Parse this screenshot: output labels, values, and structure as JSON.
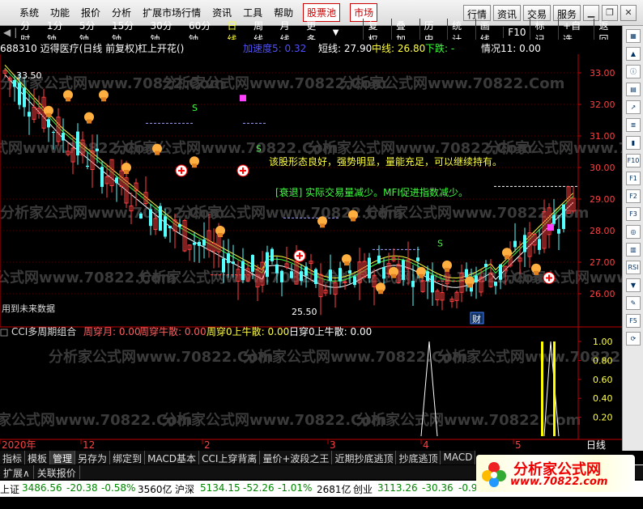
{
  "menu": {
    "items": [
      "系统",
      "功能",
      "报价",
      "分析",
      "扩展市场行情",
      "资讯",
      "工具",
      "帮助"
    ],
    "stock_pool": "股票池",
    "market": "市场",
    "right_buttons": [
      "行情",
      "资讯",
      "交易",
      "服务"
    ]
  },
  "period_bar": {
    "periods": [
      "分时",
      "1分钟",
      "5分钟",
      "15分钟",
      "30分钟",
      "60分钟",
      "日线",
      "周线",
      "月线",
      "更多"
    ],
    "active": "日线",
    "right": [
      "复权",
      "叠加",
      "历史",
      "统计",
      "画线",
      "F10",
      "标记",
      "+自选",
      "返回"
    ]
  },
  "info": {
    "code_name": "688310 迈得医疗(日线 前复权)",
    "indicator": "杠上开花()",
    "accel": "加速度5: 0.32",
    "short_line": "短线: 27.90",
    "mid_line": "中线: 26.80",
    "down": "下跌: -",
    "mood": "情况11: 0.00"
  },
  "main_chart": {
    "price_ticks": [
      "33.00",
      "32.00",
      "31.00",
      "30.00",
      "29.00",
      "28.00",
      "27.00",
      "26.00"
    ],
    "price_top_label": "33.50",
    "price_low_label": "25.50",
    "annotation1": "该股形态良好，强势明显，量能充足，可以继续持有。",
    "annotation2": "[衰退] 实际交易量减少。MFI促进指数减少。",
    "future_text": "用到未来数据",
    "cai": "财",
    "watermark": "分析家公式网www.70822.Com"
  },
  "sub_chart": {
    "title": "CCI多周期组合",
    "labels": [
      {
        "text": "周穿月: 0.00",
        "color": "#ff6060"
      },
      {
        "text": "周穿牛散: 0.00",
        "color": "#ff6060"
      },
      {
        "text": "周穿0上牛散: 0.00",
        "color": "#ffff40"
      },
      {
        "text": "日穿0上牛散: 0.00",
        "color": "#ffffff"
      }
    ],
    "ticks": [
      "1.00",
      "0.80",
      "0.60",
      "0.40",
      "0.20"
    ]
  },
  "x_axis": {
    "labels": [
      "2020年",
      "12",
      "2",
      "3",
      "4",
      "5"
    ],
    "period": "日线"
  },
  "tabs": [
    "指标",
    "模板",
    "管理",
    "另存为",
    "绑定到",
    "MACD基本",
    "CCI上穿背离",
    "量价+波段之王",
    "近期抄底逃顶",
    "抄底逃顶",
    "MACD"
  ],
  "tabs2": [
    "扩展∧",
    "关联报价"
  ],
  "status": {
    "sh_label": "上证",
    "sh_index": "3486.56",
    "sh_change": "-20.38",
    "sh_pct": "-0.58%",
    "sh_amount": "3560亿",
    "sz_label": "沪深",
    "sz_index": "5134.15",
    "sz_change": "-52.26",
    "sz_pct": "-1.01%",
    "sz_amount": "2681亿",
    "cy_label": "创业",
    "cy_index": "3113.26",
    "cy_change": "-30.36",
    "cy_pct": "-0.9"
  },
  "logo": {
    "title": "分析家公式网",
    "url": "www.70822.com"
  },
  "right_toolbar_icons": [
    "layout-icon",
    "up-arrow-icon",
    "info-icon",
    "grid-icon",
    "chart-icon",
    "list-icon",
    "candle-icon",
    "f10-icon",
    "f1-icon",
    "f2-icon",
    "f3-icon",
    "circle-icon",
    "bar-icon",
    "rsi-icon",
    "down-arrow-icon",
    "pen-icon",
    "f5-icon",
    "refresh-icon"
  ],
  "colors": {
    "up": "#ff4040",
    "down": "#54ffff",
    "bg": "#000000",
    "axis": "#c00000"
  }
}
